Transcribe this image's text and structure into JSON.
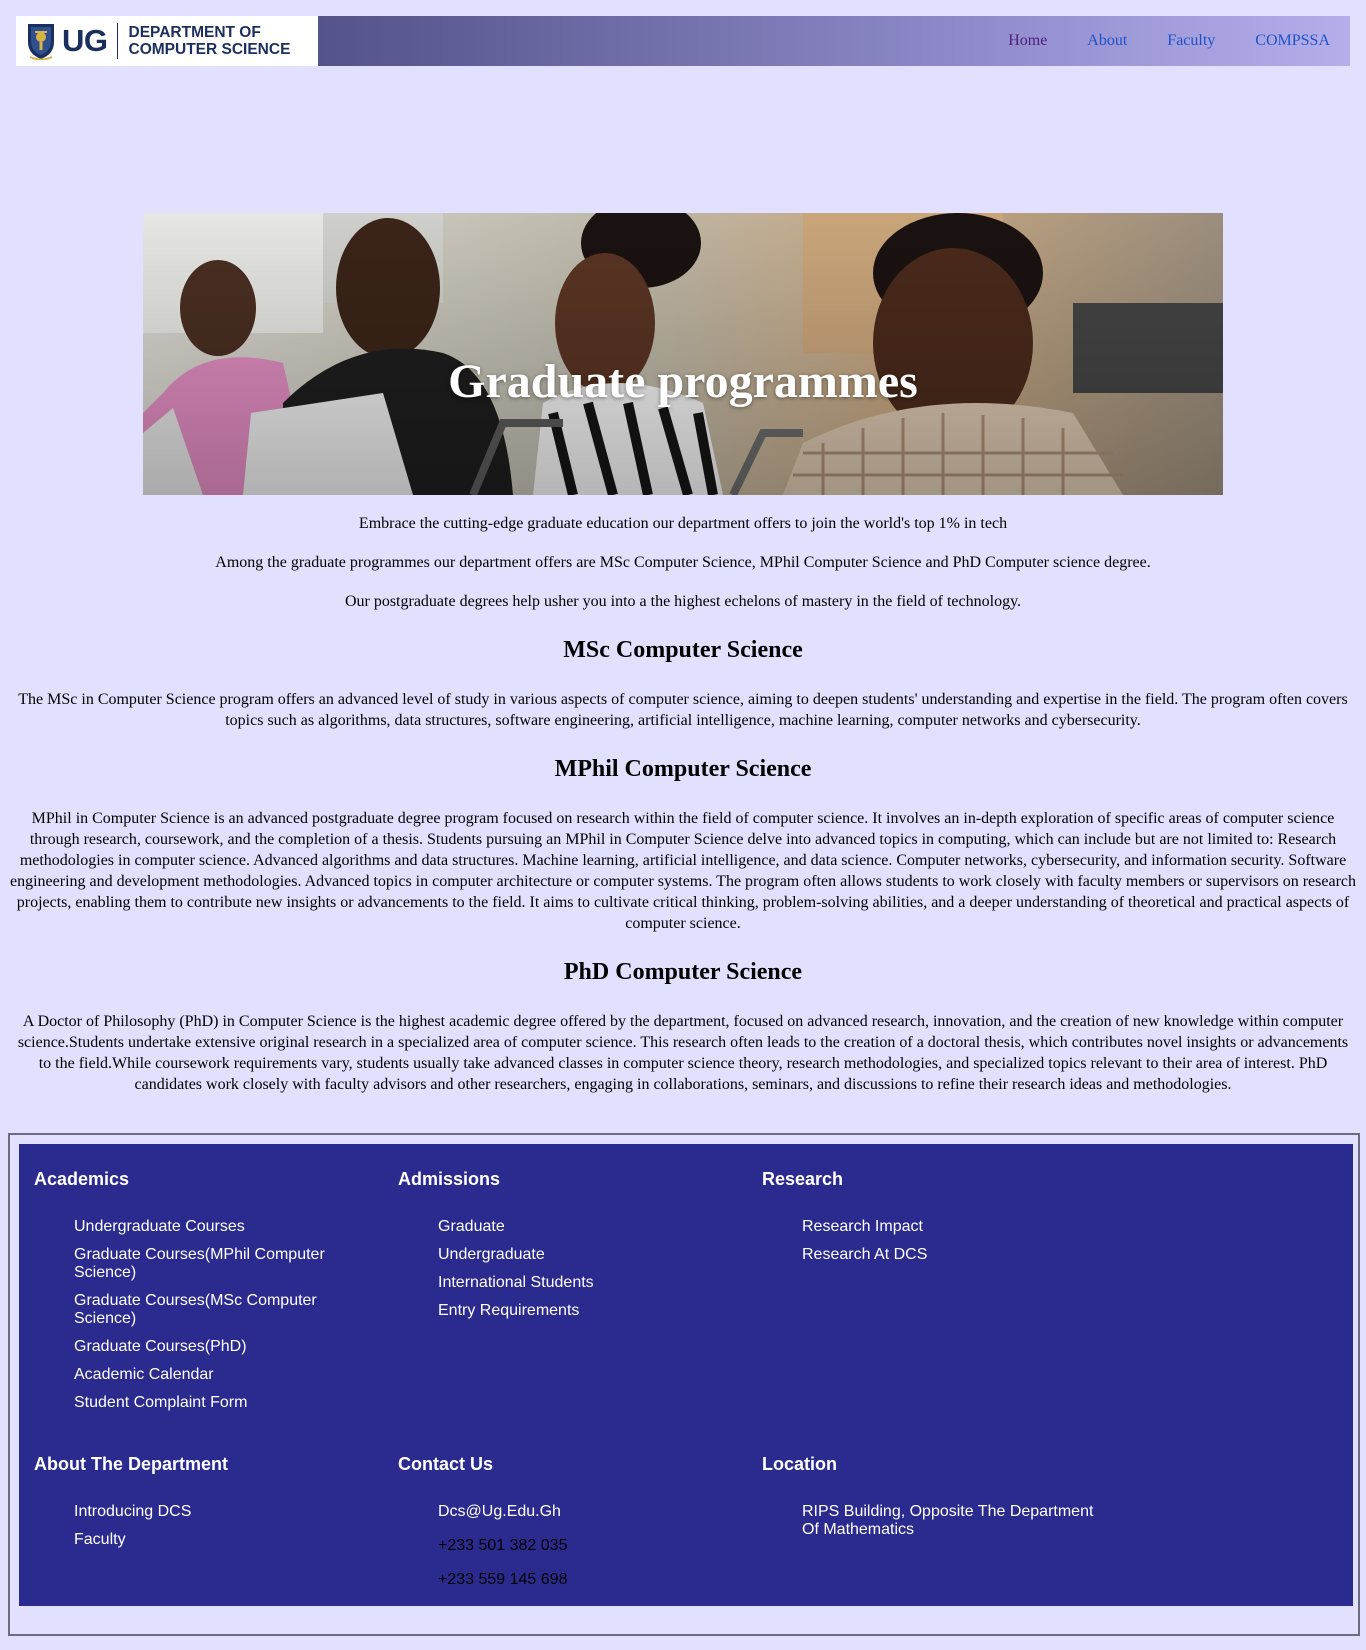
{
  "header": {
    "logo_ug": "UG",
    "logo_dept_line1": "DEPARTMENT OF",
    "logo_dept_line2": "COMPUTER SCIENCE",
    "nav": [
      {
        "label": "Home"
      },
      {
        "label": "About"
      },
      {
        "label": "Faculty"
      },
      {
        "label": "COMPSSA"
      }
    ]
  },
  "hero": {
    "title": "Graduate programmes"
  },
  "intro": [
    "Embrace the cutting-edge graduate education our department offers to join the world's top 1% in tech",
    "Among the graduate programmes our department offers are MSc Computer Science, MPhil Computer Science and PhD Computer science degree.",
    "Our postgraduate degrees help usher you into a the highest echelons of mastery in the field of technology."
  ],
  "sections": [
    {
      "heading": "MSc Computer Science",
      "body": "The MSc in Computer Science program offers an advanced level of study in various aspects of computer science, aiming to deepen students' understanding and expertise in the field. The program often covers topics such as algorithms, data structures, software engineering, artificial intelligence, machine learning, computer networks and cybersecurity."
    },
    {
      "heading": "MPhil Computer Science",
      "body": "MPhil in Computer Science is an advanced postgraduate degree program focused on research within the field of computer science. It involves an in-depth exploration of specific areas of computer science through research, coursework, and the completion of a thesis. Students pursuing an MPhil in Computer Science delve into advanced topics in computing, which can include but are not limited to: Research methodologies in computer science. Advanced algorithms and data structures. Machine learning, artificial intelligence, and data science. Computer networks, cybersecurity, and information security. Software engineering and development methodologies. Advanced topics in computer architecture or computer systems. The program often allows students to work closely with faculty members or supervisors on research projects, enabling them to contribute new insights or advancements to the field. It aims to cultivate critical thinking, problem-solving abilities, and a deeper understanding of theoretical and practical aspects of computer science."
    },
    {
      "heading": "PhD Computer Science",
      "body": "A Doctor of Philosophy (PhD) in Computer Science is the highest academic degree offered by the department, focused on advanced research, innovation, and the creation of new knowledge within computer science.Students undertake extensive original research in a specialized area of computer science. This research often leads to the creation of a doctoral thesis, which contributes novel insights or advancements to the field.While coursework requirements vary, students usually take advanced classes in computer science theory, research methodologies, and specialized topics relevant to their area of interest. PhD candidates work closely with faculty advisors and other researchers, engaging in collaborations, seminars, and discussions to refine their research ideas and methodologies."
    }
  ],
  "footer": {
    "academics": {
      "title": "Academics",
      "items": [
        "Undergraduate Courses",
        "Graduate Courses(MPhil Computer Science)",
        "Graduate Courses(MSc Computer Science)",
        "Graduate Courses(PhD)",
        "Academic Calendar",
        "Student Complaint Form"
      ]
    },
    "admissions": {
      "title": "Admissions",
      "items": [
        "Graduate",
        "Undergraduate",
        "International Students",
        "Entry Requirements"
      ]
    },
    "research": {
      "title": "Research",
      "items": [
        "Research Impact",
        "Research At DCS"
      ]
    },
    "about": {
      "title": "About The Department",
      "items": [
        "Introducing DCS",
        "Faculty"
      ]
    },
    "contact": {
      "title": "Contact Us",
      "email": "Dcs@Ug.Edu.Gh",
      "phone1": "+233 501 382 035",
      "phone2": "+233 559 145 698"
    },
    "location": {
      "title": "Location",
      "address": "RIPS Building, Opposite The Department Of Mathematics"
    }
  },
  "colors": {
    "page_bg": "#e1e0fe",
    "footer_bg": "#2b2a8f",
    "nav_link": "#1e53c8",
    "nav_visited": "#4e1c80",
    "logo_navy": "#1b2f5e"
  }
}
